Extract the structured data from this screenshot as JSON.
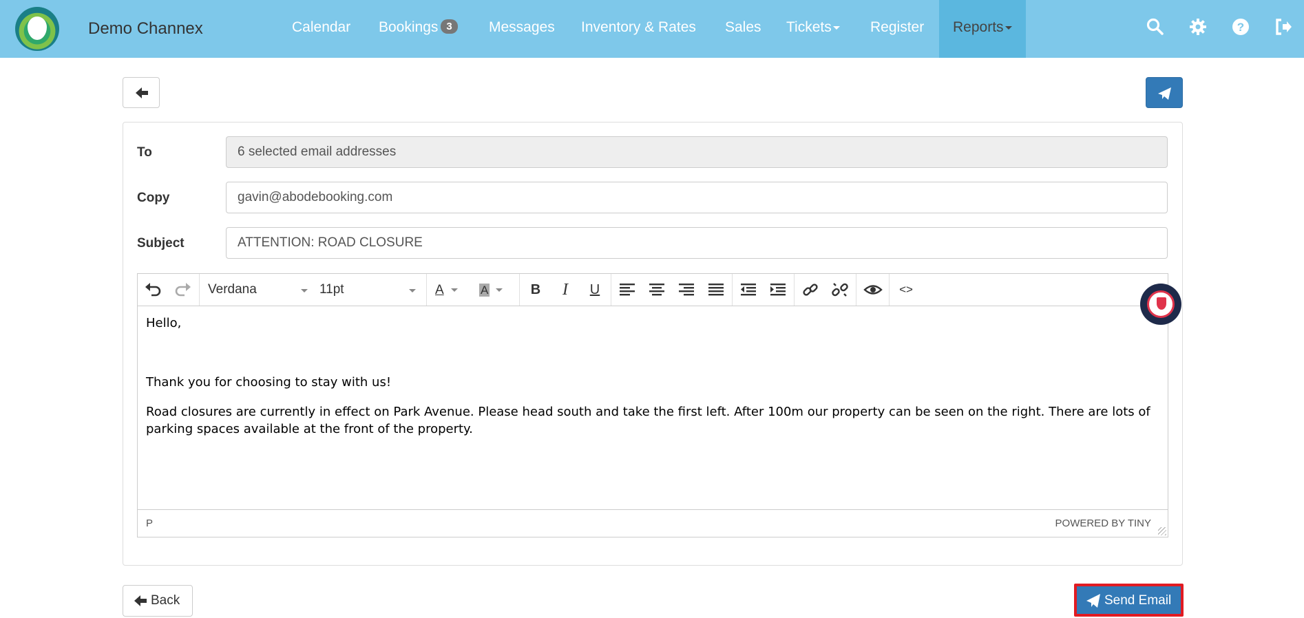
{
  "app": {
    "brand": "Demo Channex"
  },
  "nav": {
    "items": [
      {
        "label": "Calendar"
      },
      {
        "label": "Bookings",
        "badge": "3"
      },
      {
        "label": "Messages"
      },
      {
        "label": "Inventory & Rates"
      },
      {
        "label": "Sales"
      },
      {
        "label": "Tickets"
      },
      {
        "label": "Register"
      },
      {
        "label": "Reports"
      }
    ],
    "icons": [
      "search-icon",
      "gear-icon",
      "question-circle-icon",
      "sign-out-icon"
    ]
  },
  "colors": {
    "navbar": "#7ec8ea",
    "active_nav": "#5bb7df",
    "primary": "#337ab7",
    "highlight": "#e11b22"
  },
  "form": {
    "to_label": "To",
    "to_value": "6 selected email addresses",
    "copy_label": "Copy",
    "copy_value": "gavin@abodebooking.com",
    "subject_label": "Subject",
    "subject_value": "ATTENTION: ROAD CLOSURE"
  },
  "editor": {
    "font_family": "Verdana",
    "font_size": "11pt",
    "text_color_glyph": "A",
    "bg_color_glyph": "A",
    "bold_glyph": "B",
    "italic_glyph": "I",
    "underline_glyph": "U",
    "code_glyph": "<>",
    "paragraphs": [
      "Hello,",
      "",
      "Thank you for choosing to stay with us!",
      "Road closures are currently in effect on Park Avenue. Please head south and take the first left. After 100m our property can be seen on the right. There are lots of parking spaces available at the front of the property."
    ],
    "status_path": "P",
    "powered_by": "POWERED BY TINY"
  },
  "buttons": {
    "back_label": "Back",
    "send_label": "Send Email"
  }
}
